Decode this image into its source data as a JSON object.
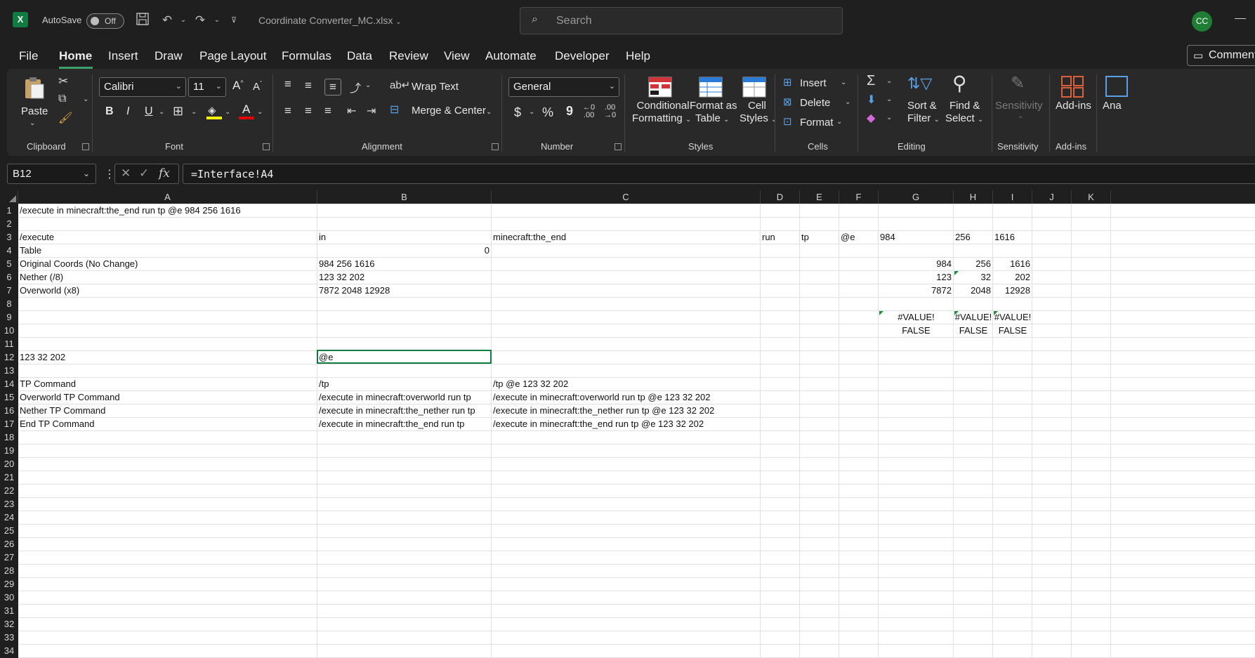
{
  "titlebar": {
    "app_icon": "X",
    "autosave_label": "AutoSave",
    "autosave_state": "Off",
    "filename": "Coordinate Converter_MC.xlsx",
    "search_placeholder": "Search",
    "avatar_initials": "CC"
  },
  "menu": {
    "tabs": [
      "File",
      "Home",
      "Insert",
      "Draw",
      "Page Layout",
      "Formulas",
      "Data",
      "Review",
      "View",
      "Automate",
      "Developer",
      "Help"
    ],
    "active": "Home",
    "comments_label": "Comments"
  },
  "ribbon": {
    "clipboard": {
      "label": "Clipboard",
      "paste": "Paste"
    },
    "font": {
      "label": "Font",
      "family": "Calibri",
      "size": "11",
      "bold": "B",
      "italic": "I",
      "underline": "U"
    },
    "alignment": {
      "label": "Alignment",
      "wrap_text": "Wrap Text",
      "merge_center": "Merge & Center"
    },
    "number": {
      "label": "Number",
      "format": "General",
      "currency": "$",
      "percent": "%",
      "comma": "9"
    },
    "styles": {
      "label": "Styles",
      "conditional_1": "Conditional",
      "conditional_2": "Formatting",
      "format_table_1": "Format as",
      "format_table_2": "Table",
      "cell_styles_1": "Cell",
      "cell_styles_2": "Styles"
    },
    "cells": {
      "label": "Cells",
      "insert": "Insert",
      "delete": "Delete",
      "format": "Format"
    },
    "editing": {
      "label": "Editing",
      "sort_1": "Sort &",
      "sort_2": "Filter",
      "find_1": "Find &",
      "find_2": "Select"
    },
    "sensitivity": {
      "label": "Sensitivity",
      "button": "Sensitivity"
    },
    "addins": {
      "label": "Add-ins",
      "button": "Add-ins",
      "partial": "Ana"
    }
  },
  "formula_bar": {
    "name_box": "B12",
    "fx": "fx",
    "formula": "=Interface!A4"
  },
  "sheet": {
    "columns": [
      "A",
      "B",
      "C",
      "D",
      "E",
      "F",
      "G",
      "H",
      "I",
      "J",
      "K"
    ],
    "rows": [
      "1",
      "2",
      "3",
      "4",
      "5",
      "6",
      "7",
      "8",
      "9",
      "10",
      "11",
      "12",
      "13",
      "14",
      "15",
      "16",
      "17",
      "18",
      "19",
      "20",
      "21",
      "22",
      "23",
      "24",
      "25",
      "26",
      "27",
      "28",
      "29",
      "30",
      "31",
      "32",
      "33",
      "34"
    ],
    "cells": {
      "A1": "/execute in minecraft:the_end run tp @e 984 256 1616",
      "A3": "/execute",
      "B3": "in",
      "C3": "minecraft:the_end",
      "D3": "run",
      "E3": "tp",
      "F3": "@e",
      "G3": "984",
      "H3": "256",
      "I3": "1616",
      "A4": "Table",
      "B4": "0",
      "A5": "Original Coords (No Change)",
      "B5": "984 256 1616",
      "G5": "984",
      "H5": "256",
      "I5": "1616",
      "A6": "Nether (/8)",
      "B6": "123 32 202",
      "G6": "123",
      "H6": "32",
      "I6": "202",
      "A7": "Overworld (x8)",
      "B7": "7872 2048 12928",
      "G7": "7872",
      "H7": "2048",
      "I7": "12928",
      "G9": "#VALUE!",
      "H9": "#VALUE!",
      "I9": "#VALUE!",
      "G10": "FALSE",
      "H10": "FALSE",
      "I10": "FALSE",
      "A12": "123 32 202",
      "B12": "@e",
      "A14": "TP Command",
      "B14": "/tp",
      "C14": "/tp @e 123 32 202",
      "A15": "Overworld TP Command",
      "B15": "/execute in minecraft:overworld run tp",
      "C15": "/execute in minecraft:overworld run tp @e 123 32 202",
      "A16": "Nether TP Command",
      "B16": "/execute in minecraft:the_nether run tp",
      "C16": "/execute in minecraft:the_nether run tp @e 123 32 202",
      "A17": "End TP Command",
      "B17": "/execute in minecraft:the_end run tp",
      "C17": "/execute in minecraft:the_end run tp @e 123 32 202"
    }
  }
}
